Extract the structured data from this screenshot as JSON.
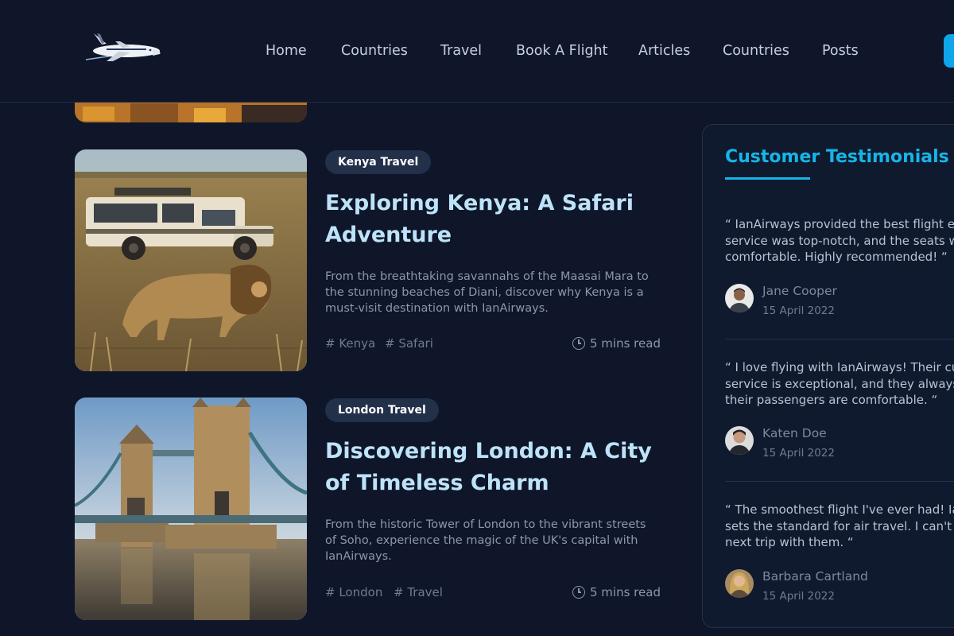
{
  "header": {
    "nav": [
      "Home",
      "Countries",
      "Travel",
      "Book A Flight",
      "Articles",
      "Countries",
      "Posts"
    ]
  },
  "articles": [
    {
      "badge": "Kenya Travel",
      "title": "Exploring Kenya: A Safari Adventure",
      "description": "From the breathtaking savannahs of the Maasai Mara to the stunning beaches of Diani, discover why Kenya is a must-visit destination with IanAirways.",
      "tags": [
        "# Kenya",
        "# Safari"
      ],
      "read_time": "5 mins read"
    },
    {
      "badge": "London Travel",
      "title": "Discovering London: A City of Timeless Charm",
      "description": "From the historic Tower of London to the vibrant streets of Soho, experience the magic of the UK's capital with IanAirways.",
      "tags": [
        "# London",
        "# Travel"
      ],
      "read_time": "5 mins read"
    }
  ],
  "testimonials": {
    "title": "Customer Testimonials",
    "items": [
      {
        "lines": [
          "“ IanAirways provided the best flight exp",
          "service was top-notch, and the seats we",
          "comfortable. Highly recommended! “"
        ],
        "name": "Jane Cooper",
        "date": "15 April 2022"
      },
      {
        "lines": [
          "“ I love flying with IanAirways! Their cus",
          "service is exceptional, and they always m",
          "their passengers are comfortable. “"
        ],
        "name": "Katen Doe",
        "date": "15 April 2022"
      },
      {
        "lines": [
          "“ The smoothest flight I've ever had! Ian",
          "sets the standard for air travel. I can't w",
          "next trip with them. “"
        ],
        "name": "Barbara Cartland",
        "date": "15 April 2022"
      }
    ]
  },
  "icons": {
    "logo": "airplane-logo",
    "read_time": "clock-icon"
  },
  "colors": {
    "background": "#0f1629",
    "accent": "#16b5e8",
    "title": "#bde3f8",
    "badge": "#22304a"
  }
}
